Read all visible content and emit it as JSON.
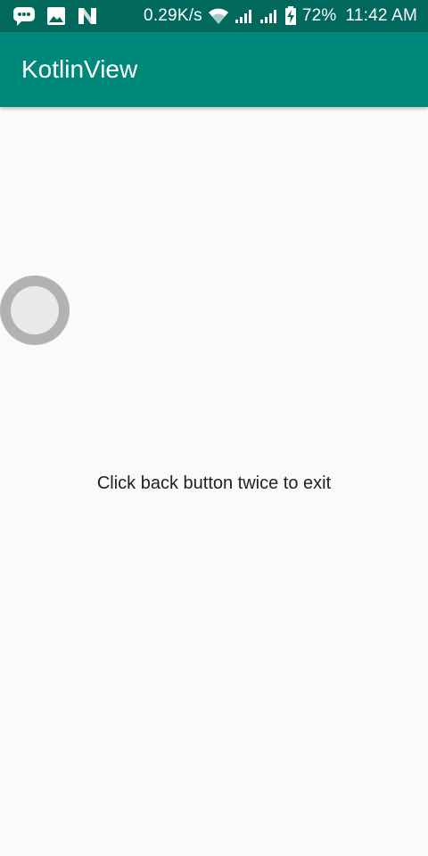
{
  "status_bar": {
    "left_icons": [
      "chat-bubble-icon",
      "image-icon",
      "n-logo-icon"
    ],
    "network_speed": "0.29K/s",
    "right_icons": [
      "wifi-icon",
      "signal-icon",
      "signal-icon",
      "battery-charging-icon"
    ],
    "battery": "72%",
    "time": "11:42 AM"
  },
  "app_bar": {
    "title": "KotlinView",
    "color": "#00897b"
  },
  "content": {
    "message": "Click back button twice to exit",
    "floating_control": "floating-circle-button"
  },
  "colors": {
    "status_bar": "#00695c",
    "app_bar": "#00897b",
    "background": "#fafafa",
    "circle_outer": "#b2b2b2",
    "circle_inner": "#e9e9e9"
  }
}
